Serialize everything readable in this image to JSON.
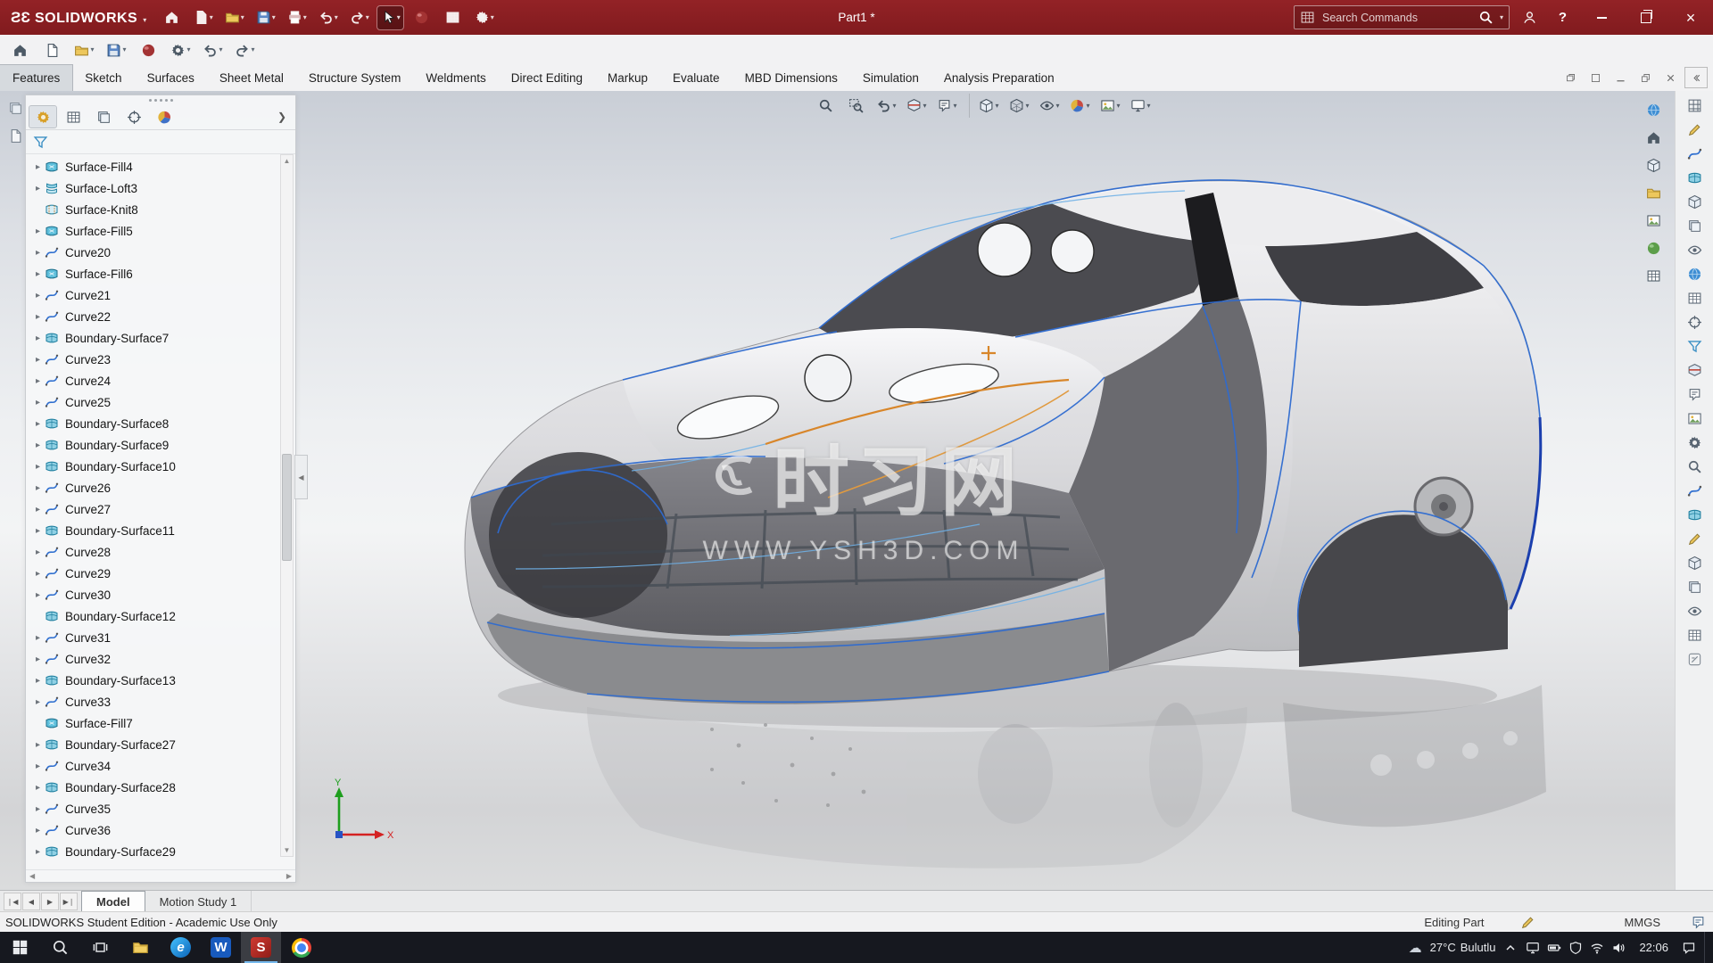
{
  "window": {
    "brand_mark": "ЗS",
    "brand": "SOLIDWORKS",
    "doc_title": "Part1 *"
  },
  "titlebar": {
    "search_placeholder": "Search Commands",
    "icons": [
      {
        "name": "home-button",
        "icon": "home"
      },
      {
        "name": "new-document-button",
        "icon": "doc",
        "caret": true
      },
      {
        "name": "open-document-button",
        "icon": "folder",
        "caret": true
      },
      {
        "name": "save-button",
        "icon": "save",
        "caret": true
      },
      {
        "name": "print-button",
        "icon": "print",
        "caret": true
      },
      {
        "name": "undo-button",
        "icon": "undo",
        "caret": true
      },
      {
        "name": "redo-button",
        "icon": "redo",
        "caret": true
      },
      {
        "name": "select-tool-button",
        "icon": "cursor",
        "caret": true,
        "active": true
      },
      {
        "name": "rebuild-button",
        "icon": "sphere-red"
      },
      {
        "name": "file-properties-button",
        "icon": "table"
      },
      {
        "name": "options-button",
        "icon": "gear",
        "caret": true
      }
    ]
  },
  "quickbar": {
    "icons": [
      {
        "name": "home-button",
        "icon": "home"
      },
      {
        "name": "new-document-button",
        "icon": "doc"
      },
      {
        "name": "open-document-button",
        "icon": "folder",
        "caret": true
      },
      {
        "name": "save-button",
        "icon": "save",
        "caret": true
      },
      {
        "name": "rebuild-button",
        "icon": "sphere-red"
      },
      {
        "name": "options-button",
        "icon": "gear",
        "caret": true
      },
      {
        "name": "undo-button",
        "icon": "undo",
        "caret": true
      },
      {
        "name": "redo-button",
        "icon": "redo",
        "caret": true
      }
    ]
  },
  "ribbon": {
    "tabs": [
      {
        "label": "Features",
        "active": true
      },
      {
        "label": "Sketch"
      },
      {
        "label": "Surfaces"
      },
      {
        "label": "Sheet Metal"
      },
      {
        "label": "Structure System"
      },
      {
        "label": "Weldments"
      },
      {
        "label": "Direct Editing"
      },
      {
        "label": "Markup"
      },
      {
        "label": "Evaluate"
      },
      {
        "label": "MBD Dimensions"
      },
      {
        "label": "Simulation"
      },
      {
        "label": "Analysis Preparation"
      }
    ]
  },
  "feature_tree": {
    "header_tabs": [
      {
        "name": "featuremanager-design-tree-tab",
        "icon": "gear-y",
        "active": true
      },
      {
        "name": "propertymanager-tab",
        "icon": "table"
      },
      {
        "name": "configurationmanager-tab",
        "icon": "layers"
      },
      {
        "name": "dimxpertmanager-tab",
        "icon": "target"
      },
      {
        "name": "displaymanager-tab",
        "icon": "sphere-multi"
      }
    ],
    "items": [
      {
        "label": "Surface-Fill4",
        "type": "fill",
        "arrow": true
      },
      {
        "label": "Surface-Loft3",
        "type": "loft",
        "arrow": true
      },
      {
        "label": "Surface-Knit8",
        "type": "knit",
        "arrow": false
      },
      {
        "label": "Surface-Fill5",
        "type": "fill",
        "arrow": true
      },
      {
        "label": "Curve20",
        "type": "curve",
        "arrow": true
      },
      {
        "label": "Surface-Fill6",
        "type": "fill",
        "arrow": true
      },
      {
        "label": "Curve21",
        "type": "curve",
        "arrow": true
      },
      {
        "label": "Curve22",
        "type": "curve",
        "arrow": true
      },
      {
        "label": "Boundary-Surface7",
        "type": "boundary",
        "arrow": true
      },
      {
        "label": "Curve23",
        "type": "curve",
        "arrow": true
      },
      {
        "label": "Curve24",
        "type": "curve",
        "arrow": true
      },
      {
        "label": "Curve25",
        "type": "curve",
        "arrow": true
      },
      {
        "label": "Boundary-Surface8",
        "type": "boundary",
        "arrow": true
      },
      {
        "label": "Boundary-Surface9",
        "type": "boundary",
        "arrow": true
      },
      {
        "label": "Boundary-Surface10",
        "type": "boundary",
        "arrow": true
      },
      {
        "label": "Curve26",
        "type": "curve",
        "arrow": true
      },
      {
        "label": "Curve27",
        "type": "curve",
        "arrow": true
      },
      {
        "label": "Boundary-Surface11",
        "type": "boundary",
        "arrow": true
      },
      {
        "label": "Curve28",
        "type": "curve",
        "arrow": true
      },
      {
        "label": "Curve29",
        "type": "curve",
        "arrow": true
      },
      {
        "label": "Curve30",
        "type": "curve",
        "arrow": true
      },
      {
        "label": "Boundary-Surface12",
        "type": "boundary",
        "arrow": false
      },
      {
        "label": "Curve31",
        "type": "curve",
        "arrow": true
      },
      {
        "label": "Curve32",
        "type": "curve",
        "arrow": true
      },
      {
        "label": "Boundary-Surface13",
        "type": "boundary",
        "arrow": true
      },
      {
        "label": "Curve33",
        "type": "curve",
        "arrow": true
      },
      {
        "label": "Surface-Fill7",
        "type": "fill",
        "arrow": false
      },
      {
        "label": "Boundary-Surface27",
        "type": "boundary",
        "arrow": true
      },
      {
        "label": "Curve34",
        "type": "curve",
        "arrow": true
      },
      {
        "label": "Boundary-Surface28",
        "type": "boundary",
        "arrow": true
      },
      {
        "label": "Curve35",
        "type": "curve",
        "arrow": true
      },
      {
        "label": "Curve36",
        "type": "curve",
        "arrow": true
      },
      {
        "label": "Boundary-Surface29",
        "type": "boundary",
        "arrow": true
      }
    ]
  },
  "viewport": {
    "headsup": [
      {
        "name": "zoom-to-fit-button",
        "icon": "search"
      },
      {
        "name": "zoom-to-area-button",
        "icon": "zoom-area"
      },
      {
        "name": "previous-view-button",
        "icon": "undo",
        "caret": true
      },
      {
        "name": "section-view-button",
        "icon": "section",
        "caret": true
      },
      {
        "name": "dynamic-annotation-views-button",
        "icon": "annotation",
        "caret": true
      },
      {
        "name": "view-orientation-button",
        "icon": "cube",
        "caret": true,
        "sep": true
      },
      {
        "name": "display-style-button",
        "icon": "cube-wire",
        "caret": true
      },
      {
        "name": "hide-show-items-button",
        "icon": "eye",
        "caret": true
      },
      {
        "name": "edit-appearance-button",
        "icon": "sphere-multi",
        "caret": true
      },
      {
        "name": "apply-scene-button",
        "icon": "picture",
        "caret": true
      },
      {
        "name": "view-settings-button",
        "icon": "monitor",
        "caret": true
      }
    ],
    "watermark": {
      "logo_text": "时习网",
      "url": "WWW.YSH3D.COM"
    },
    "triad": {
      "x_label": "X",
      "y_label": "Y"
    }
  },
  "right_view_strip": [
    {
      "name": "view-selector-button",
      "icon": "sphere-blue"
    },
    {
      "name": "home-view-button",
      "icon": "home"
    },
    {
      "name": "isometric-view-button",
      "icon": "cube"
    },
    {
      "name": "recent-views-button",
      "icon": "folder"
    },
    {
      "name": "appearances-button",
      "icon": "picture"
    },
    {
      "name": "scene-button",
      "icon": "sphere-green"
    },
    {
      "name": "display-pane-button",
      "icon": "table"
    }
  ],
  "right_tool_strip": [
    {
      "name": "toolbar-button",
      "icon": "grid"
    },
    {
      "name": "toolbar-button",
      "icon": "pencil"
    },
    {
      "name": "toolbar-button",
      "icon": "curve"
    },
    {
      "name": "toolbar-button",
      "icon": "surface"
    },
    {
      "name": "toolbar-button",
      "icon": "cube"
    },
    {
      "name": "toolbar-button",
      "icon": "layers"
    },
    {
      "name": "toolbar-button",
      "icon": "eye"
    },
    {
      "name": "toolbar-button",
      "icon": "sphere-blue"
    },
    {
      "name": "toolbar-button",
      "icon": "table"
    },
    {
      "name": "toolbar-button",
      "icon": "target"
    },
    {
      "name": "toolbar-button",
      "icon": "filter"
    },
    {
      "name": "toolbar-button",
      "icon": "section"
    },
    {
      "name": "toolbar-button",
      "icon": "annotation"
    },
    {
      "name": "toolbar-button",
      "icon": "picture"
    },
    {
      "name": "toolbar-button",
      "icon": "gear"
    },
    {
      "name": "toolbar-button",
      "icon": "search"
    },
    {
      "name": "toolbar-button",
      "icon": "curve"
    },
    {
      "name": "toolbar-button",
      "icon": "surface"
    },
    {
      "name": "toolbar-button",
      "icon": "pencil"
    },
    {
      "name": "toolbar-button",
      "icon": "cube"
    },
    {
      "name": "toolbar-button",
      "icon": "layers"
    },
    {
      "name": "toolbar-button",
      "icon": "eye"
    },
    {
      "name": "toolbar-button",
      "icon": "table"
    },
    {
      "name": "toolbar-button",
      "icon": "generic"
    }
  ],
  "left_edge_buttons": [
    {
      "name": "collapsed-panel-button",
      "icon": "layers"
    },
    {
      "name": "collapsed-panel-button",
      "icon": "doc"
    }
  ],
  "model_bar": {
    "tabs": [
      {
        "label": "Model",
        "active": true
      },
      {
        "label": "Motion Study 1"
      }
    ]
  },
  "status_bar": {
    "left": "SOLIDWORKS Student Edition - Academic Use Only",
    "mode": "Editing Part",
    "units": "MMGS"
  },
  "taskbar": {
    "apps": [
      {
        "name": "start-button",
        "kind": "start"
      },
      {
        "name": "search-button",
        "kind": "search"
      },
      {
        "name": "task-view-button",
        "kind": "taskview"
      },
      {
        "name": "file-explorer-button",
        "kind": "folder"
      },
      {
        "name": "edge-button",
        "kind": "edge",
        "label": "e"
      },
      {
        "name": "word-button",
        "kind": "word",
        "label": "W"
      },
      {
        "name": "solidworks-button",
        "kind": "sw",
        "label": "S",
        "active": true
      },
      {
        "name": "chrome-button",
        "kind": "chrome"
      }
    ],
    "weather": {
      "temp": "27°C",
      "condition": "Bulutlu"
    },
    "tray_icons": [
      {
        "name": "tray-monitor-icon",
        "icon": "monitor-w"
      },
      {
        "name": "tray-battery-icon",
        "icon": "battery"
      },
      {
        "name": "tray-shield-icon",
        "icon": "shield"
      },
      {
        "name": "tray-wifi-icon",
        "icon": "wifi"
      },
      {
        "name": "tray-volume-icon",
        "icon": "volume"
      }
    ],
    "time": "22:06"
  }
}
